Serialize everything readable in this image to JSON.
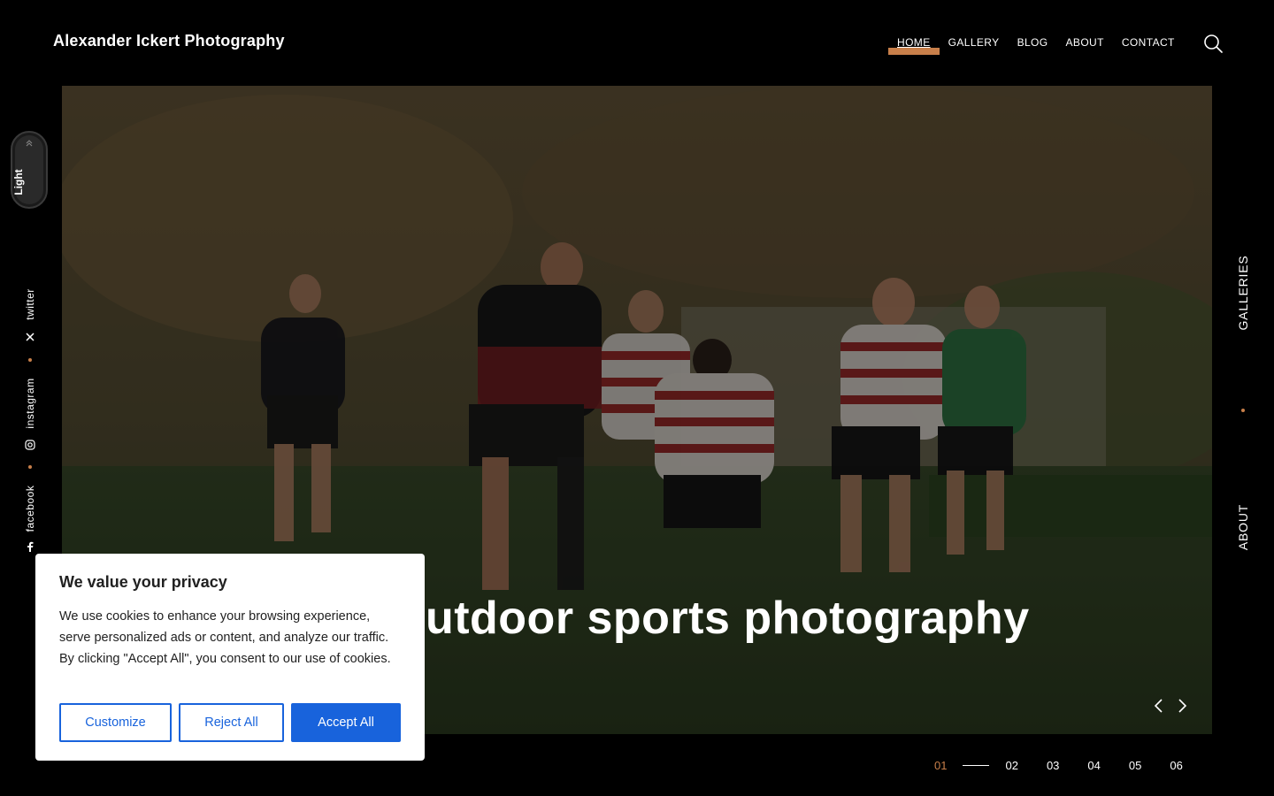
{
  "header": {
    "site_title": "Alexander Ickert Photography",
    "nav": [
      {
        "label": "HOME",
        "active": true
      },
      {
        "label": "GALLERY",
        "active": false
      },
      {
        "label": "BLOG",
        "active": false
      },
      {
        "label": "ABOUT",
        "active": false
      },
      {
        "label": "CONTACT",
        "active": false
      }
    ],
    "search_icon": "search-icon"
  },
  "theme_toggle": {
    "label": "Light",
    "icon": "chevron-up-double-icon"
  },
  "social": [
    {
      "label": "twitter",
      "icon": "x-icon"
    },
    {
      "label": "instagram",
      "icon": "instagram-icon"
    },
    {
      "label": "facebook",
      "icon": "facebook-icon"
    }
  ],
  "side_links": {
    "right_top": "GALLERIES",
    "right_bottom": "ABOUT"
  },
  "hero": {
    "title": "Outdoor sports photography",
    "prev_icon": "chevron-left-icon",
    "next_icon": "chevron-right-icon"
  },
  "pager": {
    "current": "01",
    "pages": [
      "02",
      "03",
      "04",
      "05",
      "06"
    ]
  },
  "cookie_banner": {
    "title": "We value your privacy",
    "body": "We use cookies to enhance your browsing experience, serve personalized ads or content, and analyze our traffic. By clicking \"Accept All\", you consent to our use of cookies.",
    "customize": "Customize",
    "reject": "Reject All",
    "accept": "Accept All"
  },
  "colors": {
    "accent": "#c87f4a",
    "button_blue": "#1863dc",
    "background": "#000000"
  }
}
